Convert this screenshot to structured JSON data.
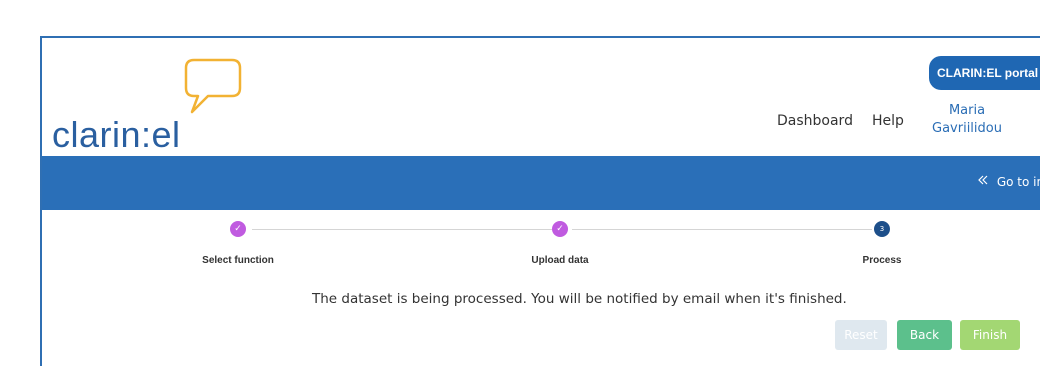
{
  "header": {
    "logo_text": "clarin:el",
    "nav": {
      "dashboard": "Dashboard",
      "help": "Help"
    },
    "user": {
      "first": "Maria",
      "last": "Gavriilidou"
    },
    "portal_button": "CLARIN:EL portal",
    "portal_chevron": "›"
  },
  "band": {
    "goto_label": "Go to inv"
  },
  "steps": [
    {
      "label": "Select function",
      "state": "done",
      "marker": "✓"
    },
    {
      "label": "Upload data",
      "state": "done",
      "marker": "✓"
    },
    {
      "label": "Process",
      "state": "current",
      "marker": "3"
    }
  ],
  "message": "The dataset is being processed. You will be notified by email when it's finished.",
  "buttons": {
    "reset": "Reset",
    "back": "Back",
    "finish": "Finish"
  },
  "colors": {
    "brand_blue": "#2a6fb8",
    "step_done": "#c05be0",
    "step_current": "#1d4f8a",
    "back_button": "#5cc08c",
    "finish_button": "#a3d773",
    "logo_bubble": "#f2b233"
  }
}
